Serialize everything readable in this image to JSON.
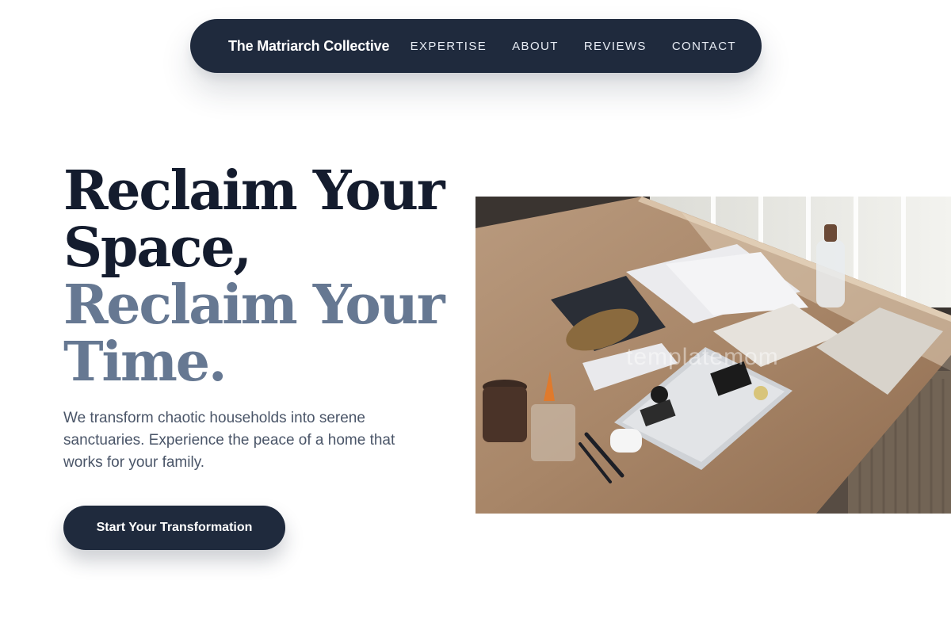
{
  "nav": {
    "brand": "The Matriarch Collective",
    "links": [
      "EXPERTISE",
      "ABOUT",
      "REVIEWS",
      "CONTACT"
    ]
  },
  "hero": {
    "title_line1": "Reclaim Your",
    "title_line2": "Space,",
    "title_line3": "Reclaim Your",
    "title_line4": "Time.",
    "subtitle": "We transform chaotic households into serene sanctuaries. Experience the peace of a home that works for your family.",
    "cta_label": "Start Your Transformation",
    "image_watermark": "templatemom"
  },
  "colors": {
    "navy": "#1f2a3d",
    "title_dark": "#141c2e",
    "title_muted": "#667892",
    "body_text": "#4a5568"
  }
}
